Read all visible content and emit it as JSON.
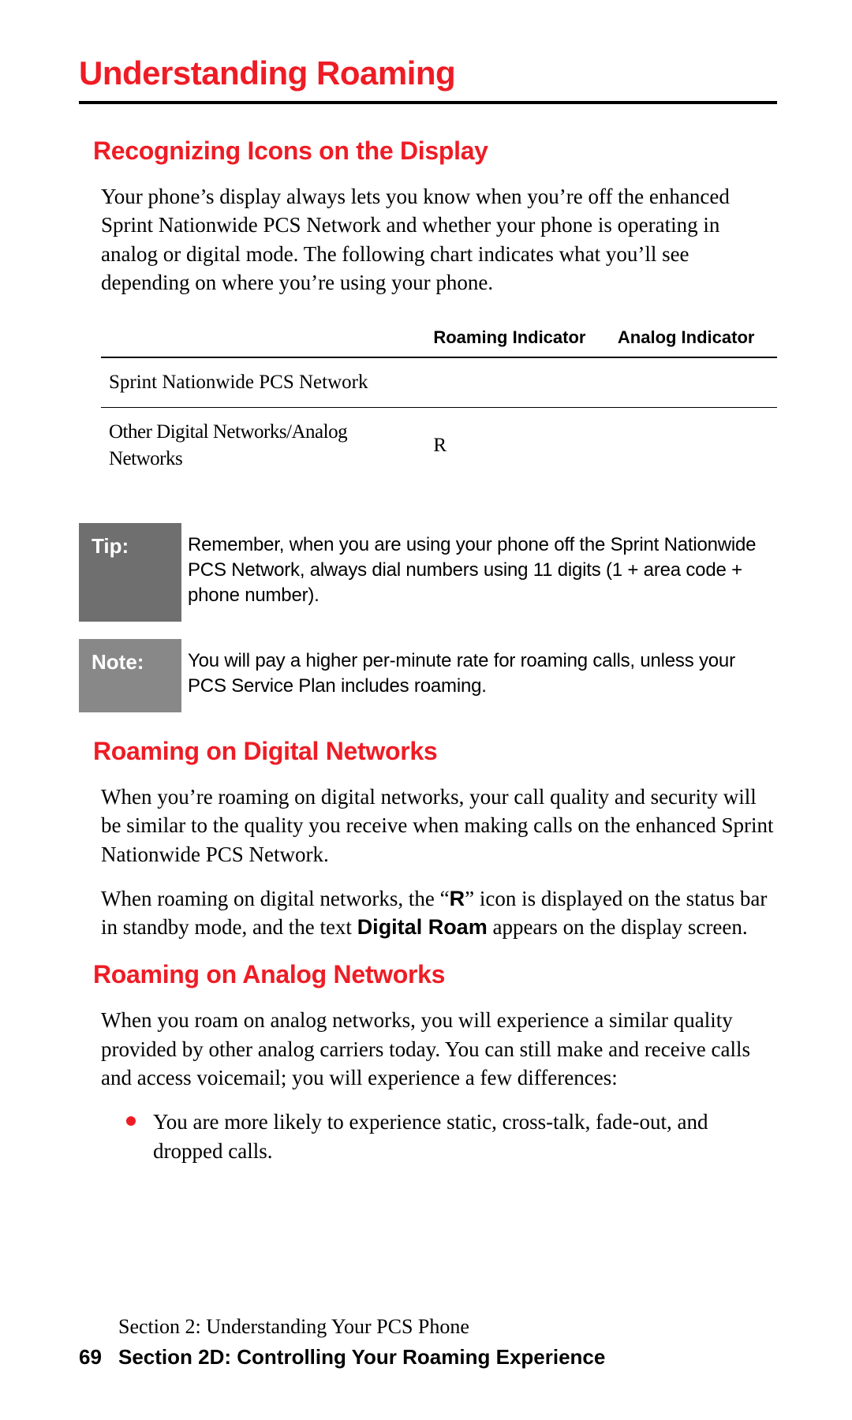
{
  "title": "Understanding Roaming",
  "sections": {
    "recognizing": {
      "heading": "Recognizing Icons on the Display",
      "para": "Your phone’s display always lets you know when you’re off the enhanced Sprint Nationwide PCS Network and whether your phone is operating in analog or digital mode. The following chart indicates what you’ll see depending on where you’re using your phone."
    },
    "table": {
      "headers": [
        "",
        "Roaming Indicator",
        "Analog Indicator"
      ],
      "rows": [
        {
          "label": "Sprint Nationwide PCS Network",
          "roaming": "",
          "analog": ""
        },
        {
          "label": "Other Digital Networks/Analog Networks",
          "roaming": "R",
          "analog": ""
        }
      ]
    },
    "tip": {
      "label": "Tip:",
      "text": "Remember, when you are using your phone off the Sprint Nationwide PCS Network, always dial numbers using 11 digits (1 + area code + phone number)."
    },
    "note": {
      "label": "Note:",
      "text": "You will pay a higher per-minute rate for roaming calls, unless your PCS Service Plan includes roaming."
    },
    "digital": {
      "heading": "Roaming on Digital Networks",
      "para1": "When you’re roaming on digital networks, your call quality and security will be similar to the quality you receive when making calls on the enhanced Sprint Nationwide PCS Network.",
      "para2_pre": "When roaming on digital networks, the “",
      "para2_icon": "R",
      "para2_mid": "” icon is displayed on the status bar in standby mode, and the text ",
      "para2_bold": "Digital Roam",
      "para2_post": " appears on the display screen."
    },
    "analog": {
      "heading": "Roaming on Analog Networks",
      "para": "When you roam on analog networks, you will experience a similar quality provided by other analog carriers today. You can still make and receive calls and access voicemail; you will experience a few differences:",
      "bullet1": "You are more likely to experience static, cross-talk, fade-out, and dropped calls."
    }
  },
  "footer": {
    "line1": "Section 2: Understanding Your PCS Phone",
    "page_num": "69",
    "line2": "Section 2D: Controlling Your Roaming Experience"
  }
}
